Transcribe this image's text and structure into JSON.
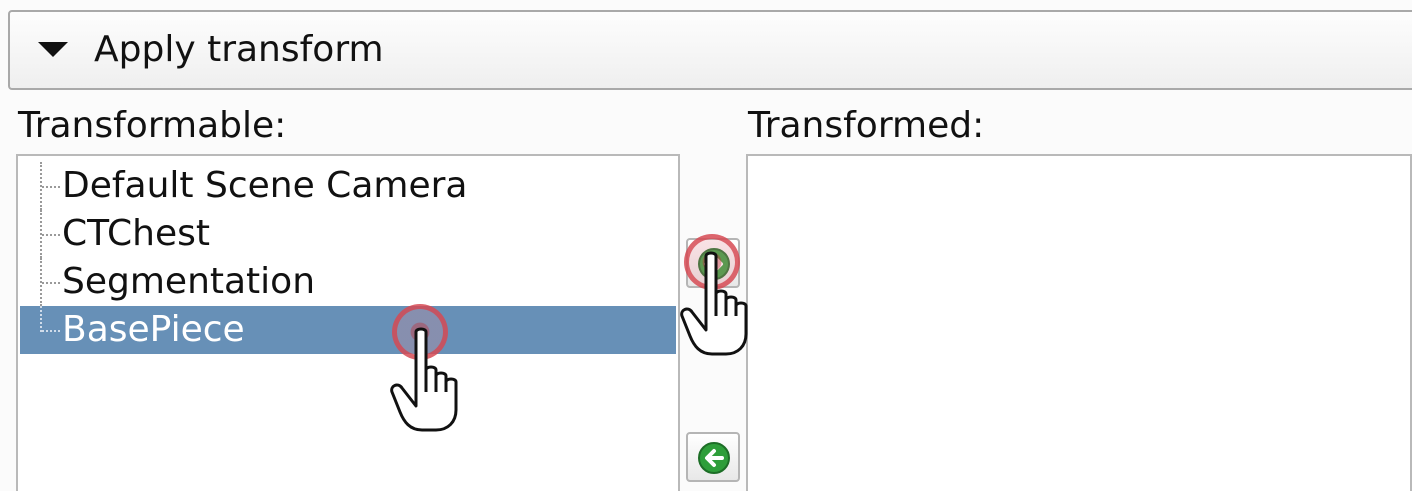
{
  "section": {
    "title": "Apply transform",
    "expanded": true
  },
  "transformable": {
    "label": "Transformable:",
    "items": [
      {
        "label": "Default Scene Camera",
        "selected": false
      },
      {
        "label": "CTChest",
        "selected": false
      },
      {
        "label": "Segmentation",
        "selected": false
      },
      {
        "label": "BasePiece",
        "selected": true
      }
    ]
  },
  "transformed": {
    "label": "Transformed:",
    "items": []
  },
  "buttons": {
    "add_icon": "right-arrow-icon",
    "remove_icon": "left-arrow-icon",
    "icon_color": "#2e9e3a"
  },
  "colors": {
    "selection": "#6790b7",
    "click_marker": "#d64650"
  }
}
